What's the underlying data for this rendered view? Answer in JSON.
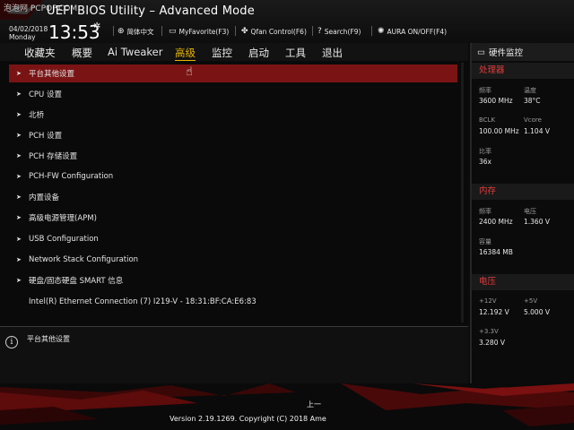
{
  "header": {
    "watermark": "泡泡网 PCPOP.COM",
    "title": "UEFI BIOS Utility – Advanced Mode",
    "date": "04/02/2018",
    "weekday": "Monday",
    "time": "13:53",
    "tools": {
      "language": "简体中文",
      "myfavorite": "MyFavorite(F3)",
      "qfan": "Qfan Control(F6)",
      "search": "Search(F9)",
      "aura": "AURA ON/OFF(F4)"
    },
    "accent_color": "#e8b500"
  },
  "nav": {
    "tabs": [
      "收藏夹",
      "概要",
      "Ai Tweaker",
      "高级",
      "监控",
      "启动",
      "工具",
      "退出"
    ],
    "active": "高级"
  },
  "menu": {
    "items": [
      "平台其他设置",
      "CPU 设置",
      "北桥",
      "PCH 设置",
      "PCH 存储设置",
      "PCH-FW Configuration",
      "内置设备",
      "高级电源管理(APM)",
      "USB Configuration",
      "Network Stack Configuration",
      "硬盘/固态硬盘 SMART 信息"
    ],
    "info_line": "Intel(R) Ethernet Connection (7) I219-V - 18:31:BF:CA:E6:83",
    "selected_color": "#7a1414"
  },
  "infobar": {
    "text": "平台其他设置"
  },
  "monitor": {
    "title": "硬件监控",
    "cpu": {
      "section": "处理器",
      "freq_label": "频率",
      "freq_value": "3600 MHz",
      "temp_label": "温度",
      "temp_value": "38°C",
      "bclk_label": "BCLK",
      "bclk_value": "100.00 MHz",
      "vcore_label": "Vcore",
      "vcore_value": "1.104 V",
      "ratio_label": "比率",
      "ratio_value": "36x"
    },
    "memory": {
      "section": "内存",
      "freq_label": "频率",
      "freq_value": "2400 MHz",
      "volt_label": "电压",
      "volt_value": "1.360 V",
      "cap_label": "容量",
      "cap_value": "16384 MB"
    },
    "voltage": {
      "section": "电压",
      "v12_label": "+12V",
      "v12_value": "12.192 V",
      "v5_label": "+5V",
      "v5_value": "5.000 V",
      "v33_label": "+3.3V",
      "v33_value": "3.280 V"
    },
    "section_color": "#e43c3c"
  },
  "footer": {
    "prev": "上一",
    "version": "Version 2.19.1269. Copyright (C) 2018 Ame"
  }
}
